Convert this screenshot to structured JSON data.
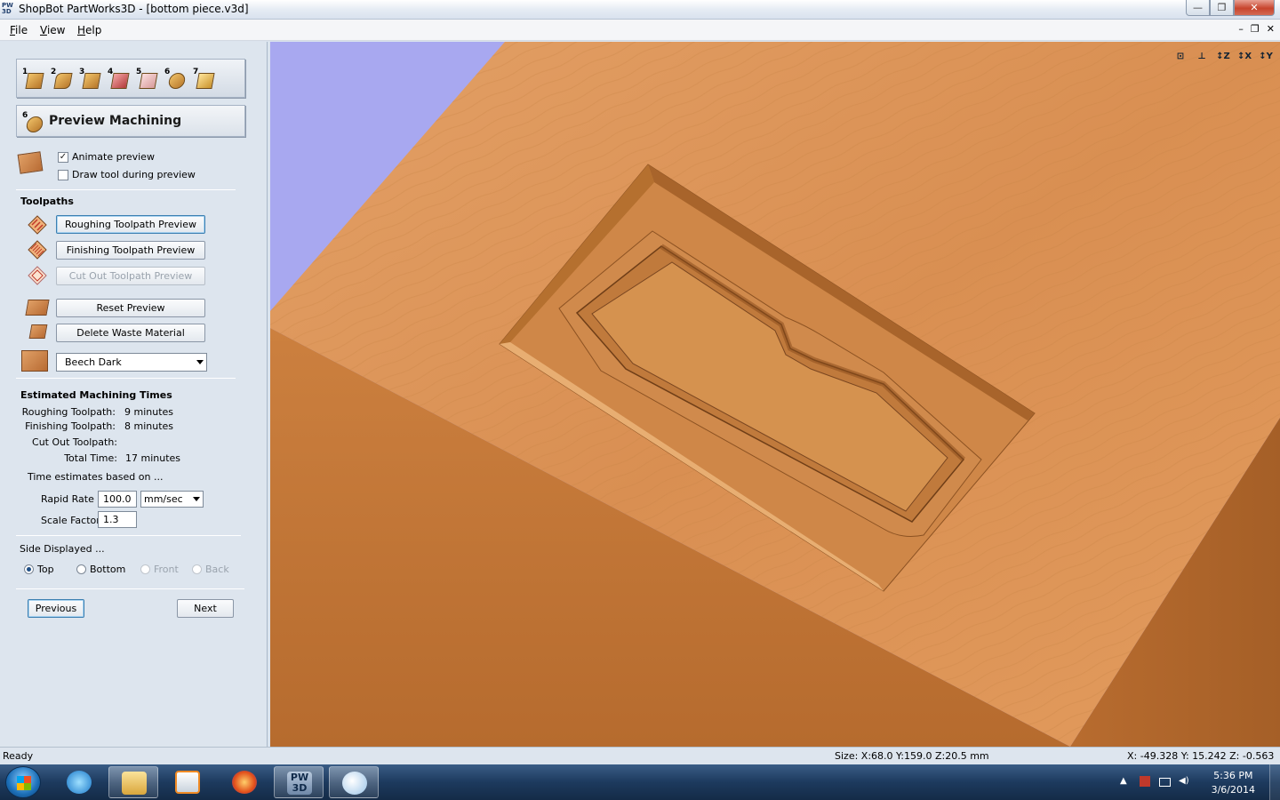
{
  "window": {
    "app_icon": "PW 3D",
    "title": "ShopBot PartWorks3D - [bottom piece.v3d]",
    "minimize": "—",
    "maximize": "❐",
    "close": "✕"
  },
  "menu": {
    "items": [
      "File",
      "View",
      "Help"
    ],
    "mdi_min": "–",
    "mdi_restore": "❐",
    "mdi_close": "✕"
  },
  "stages": [
    "1",
    "2",
    "3",
    "4",
    "5",
    "6",
    "7"
  ],
  "heading": {
    "number": "6",
    "title": "Preview Machining"
  },
  "options": {
    "animate_label": "Animate preview",
    "animate_checked": "✓",
    "draw_tool_label": "Draw tool during preview"
  },
  "toolpaths": {
    "title": "Toolpaths",
    "roughing": "Roughing Toolpath Preview",
    "finishing": "Finishing Toolpath Preview",
    "cutout": "Cut Out Toolpath Preview",
    "reset": "Reset Preview",
    "delete_waste": "Delete Waste Material",
    "material": "Beech Dark"
  },
  "estimates": {
    "title": "Estimated Machining Times",
    "rows": [
      {
        "label": "Roughing Toolpath:",
        "value": "9 minutes"
      },
      {
        "label": "Finishing Toolpath:",
        "value": "8 minutes"
      },
      {
        "label": "Cut Out Toolpath:",
        "value": ""
      },
      {
        "label": "Total Time:",
        "value": "17 minutes"
      }
    ],
    "based_on": "Time estimates based on ...",
    "rapid_rate_label": "Rapid Rate",
    "rapid_rate_value": "100.0",
    "rapid_rate_unit": "mm/sec",
    "scale_factor_label": "Scale Factor",
    "scale_factor_value": "1.3"
  },
  "side": {
    "title": "Side Displayed ...",
    "options": [
      "Top",
      "Bottom",
      "Front",
      "Back"
    ],
    "selected": "Top"
  },
  "nav": {
    "previous": "Previous",
    "next": "Next"
  },
  "view_tools": [
    "⊡",
    "⊥",
    "↕Z",
    "↕X",
    "↕Y"
  ],
  "status": {
    "ready": "Ready",
    "size": "Size: X:68.0 Y:159.0 Z:20.5 mm",
    "coords": "X: -49.328 Y: 15.242 Z: -0.563"
  },
  "taskbar": {
    "time": "5:36 PM",
    "date": "3/6/2014",
    "pw_label": "PW 3D"
  },
  "colors": {
    "viewport_bg": "#a8a8f0",
    "wood_top": "#dc9558",
    "wood_side": "#c37638",
    "wood_dark": "#9a5a26"
  }
}
